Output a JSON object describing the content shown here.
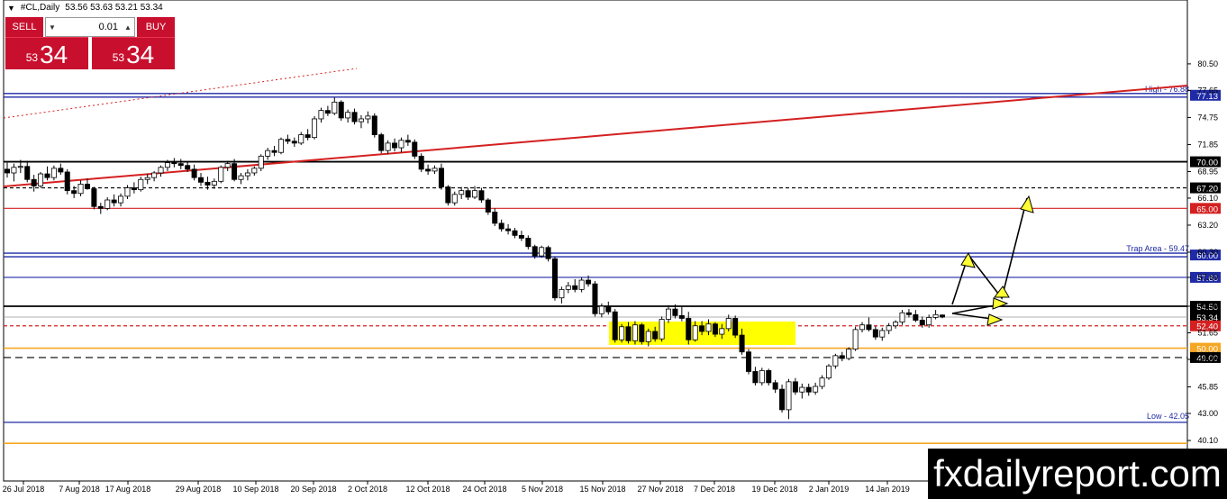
{
  "header": {
    "symbol": "#CL,Daily",
    "ohlc": "53.56 53.63 53.21 53.34"
  },
  "trade_panel": {
    "sell_label": "SELL",
    "buy_label": "BUY",
    "lot_value": "0.01",
    "sell_small": "53",
    "sell_big": "34",
    "buy_small": "53",
    "buy_big": "34"
  },
  "watermark": "fxdailyreport.com",
  "colors": {
    "bear": "#000000",
    "bull": "#ffffff",
    "red_line": "#d42020",
    "blue_line": "#1f2aa5",
    "black_line": "#000000",
    "yellow_zone": "#ffff00",
    "orange_line": "#f5a623",
    "arrow_fill": "#ffff33"
  },
  "chart_data": {
    "type": "candlestick",
    "y_ticks": [
      "80.50",
      "77.65",
      "74.75",
      "71.85",
      "68.95",
      "66.10",
      "63.20",
      "60.30",
      "57.60",
      "54.50",
      "51.65",
      "48.80",
      "45.85",
      "43.00",
      "40.10"
    ],
    "x_ticks": [
      "26 Jul 2018",
      "7 Aug 2018",
      "17 Aug 2018",
      "29 Aug 2018",
      "10 Sep 2018",
      "20 Sep 2018",
      "2 Oct 2018",
      "12 Oct 2018",
      "24 Oct 2018",
      "5 Nov 2018",
      "15 Nov 2018",
      "27 Nov 2018",
      "7 Dec 2018",
      "19 Dec 2018",
      "2 Jan 2019",
      "14 Jan 2019"
    ],
    "levels": [
      {
        "price": 77.13,
        "label": "77.13",
        "color": "blue",
        "tag_text": "High - 76.88",
        "style": "double"
      },
      {
        "price": 70.0,
        "label": "70.00",
        "color": "black",
        "style": "solid"
      },
      {
        "price": 67.2,
        "label": "67.20",
        "color": "black",
        "style": "dashed"
      },
      {
        "price": 65.0,
        "label": "65.00",
        "color": "red",
        "style": "solid"
      },
      {
        "price": 60.0,
        "label": "60.00",
        "color": "blue",
        "tag_text": "Trap Area - 59.47",
        "style": "double"
      },
      {
        "price": 57.6,
        "label": "57.60",
        "color": "blue",
        "style": "solid"
      },
      {
        "price": 54.5,
        "label": "54.50",
        "color": "black",
        "style": "solid"
      },
      {
        "price": 53.34,
        "label": "53.34",
        "color": "black",
        "style": "current"
      },
      {
        "price": 52.4,
        "label": "52.40",
        "color": "red",
        "style": "dashed"
      },
      {
        "price": 50.0,
        "label": "50.00",
        "color": "orange",
        "style": "solid"
      },
      {
        "price": 49.0,
        "label": "49.00",
        "color": "black",
        "style": "dashed"
      },
      {
        "price": 42.05,
        "label": "",
        "color": "blue",
        "tag_text": "Low - 42.05",
        "style": "solid"
      },
      {
        "price": 39.8,
        "label": "",
        "color": "orange",
        "style": "solid"
      }
    ],
    "candles": [
      [
        69.2,
        69.9,
        68.3,
        68.8
      ],
      [
        68.8,
        69.8,
        67.9,
        69.4
      ],
      [
        69.4,
        70.2,
        68.8,
        69.5
      ],
      [
        69.5,
        70.1,
        67.8,
        68.1
      ],
      [
        68.1,
        68.6,
        66.8,
        67.4
      ],
      [
        67.4,
        68.9,
        67.2,
        68.7
      ],
      [
        68.7,
        69.5,
        68.0,
        68.3
      ],
      [
        68.3,
        69.6,
        68.0,
        69.3
      ],
      [
        69.3,
        69.8,
        68.6,
        68.9
      ],
      [
        68.9,
        69.2,
        66.5,
        66.9
      ],
      [
        66.9,
        67.4,
        66.1,
        66.6
      ],
      [
        66.6,
        68.0,
        66.3,
        67.6
      ],
      [
        67.6,
        68.2,
        67.0,
        67.1
      ],
      [
        67.1,
        67.3,
        64.9,
        65.2
      ],
      [
        65.2,
        65.6,
        64.4,
        65.0
      ],
      [
        65.0,
        66.2,
        64.8,
        65.9
      ],
      [
        65.9,
        66.5,
        65.2,
        65.6
      ],
      [
        65.6,
        66.6,
        65.2,
        66.3
      ],
      [
        66.3,
        67.5,
        66.0,
        67.2
      ],
      [
        67.2,
        67.8,
        66.6,
        67.0
      ],
      [
        67.0,
        68.4,
        66.8,
        68.1
      ],
      [
        68.1,
        68.7,
        67.6,
        68.3
      ],
      [
        68.3,
        69.0,
        67.9,
        68.8
      ],
      [
        68.8,
        69.6,
        68.4,
        69.4
      ],
      [
        69.4,
        70.2,
        69.0,
        69.9
      ],
      [
        69.9,
        70.4,
        69.4,
        69.8
      ],
      [
        69.8,
        70.3,
        69.2,
        69.6
      ],
      [
        69.6,
        70.0,
        68.9,
        69.2
      ],
      [
        69.2,
        69.7,
        68.0,
        68.3
      ],
      [
        68.3,
        68.8,
        67.4,
        67.8
      ],
      [
        67.8,
        68.4,
        67.0,
        67.5
      ],
      [
        67.5,
        68.2,
        67.1,
        67.9
      ],
      [
        67.9,
        69.6,
        67.7,
        69.4
      ],
      [
        69.4,
        70.1,
        69.0,
        69.8
      ],
      [
        69.8,
        70.3,
        67.9,
        68.1
      ],
      [
        68.1,
        68.8,
        67.6,
        68.5
      ],
      [
        68.5,
        69.2,
        68.0,
        68.8
      ],
      [
        68.8,
        69.5,
        68.5,
        69.3
      ],
      [
        69.3,
        70.8,
        69.0,
        70.6
      ],
      [
        70.6,
        71.5,
        70.2,
        71.2
      ],
      [
        71.2,
        71.7,
        70.6,
        71.0
      ],
      [
        71.0,
        72.6,
        70.8,
        72.4
      ],
      [
        72.4,
        72.9,
        71.9,
        72.2
      ],
      [
        72.2,
        72.6,
        71.6,
        72.0
      ],
      [
        72.0,
        73.2,
        71.8,
        72.9
      ],
      [
        72.9,
        73.5,
        72.3,
        72.6
      ],
      [
        72.6,
        74.9,
        72.4,
        74.6
      ],
      [
        74.6,
        75.8,
        74.2,
        75.5
      ],
      [
        75.5,
        76.0,
        74.9,
        75.2
      ],
      [
        75.2,
        76.9,
        75.0,
        76.4
      ],
      [
        76.4,
        76.6,
        74.4,
        74.7
      ],
      [
        74.7,
        75.6,
        74.2,
        75.3
      ],
      [
        75.3,
        75.7,
        74.0,
        74.3
      ],
      [
        74.3,
        75.0,
        73.6,
        74.6
      ],
      [
        74.6,
        75.4,
        74.1,
        74.9
      ],
      [
        74.9,
        75.2,
        72.6,
        72.9
      ],
      [
        72.9,
        73.1,
        70.9,
        71.2
      ],
      [
        71.2,
        72.3,
        70.8,
        72.0
      ],
      [
        72.0,
        72.5,
        71.1,
        71.5
      ],
      [
        71.5,
        72.6,
        71.0,
        72.3
      ],
      [
        72.3,
        72.9,
        71.7,
        72.1
      ],
      [
        72.1,
        72.4,
        70.3,
        70.6
      ],
      [
        70.6,
        70.9,
        68.9,
        69.2
      ],
      [
        69.2,
        69.7,
        68.6,
        69.0
      ],
      [
        69.0,
        69.6,
        68.7,
        69.3
      ],
      [
        69.3,
        69.8,
        67.0,
        67.3
      ],
      [
        67.3,
        67.5,
        65.3,
        65.6
      ],
      [
        65.6,
        66.8,
        65.3,
        66.5
      ],
      [
        66.5,
        67.3,
        66.0,
        66.9
      ],
      [
        66.9,
        67.2,
        65.9,
        66.2
      ],
      [
        66.2,
        67.4,
        66.0,
        66.9
      ],
      [
        66.9,
        67.2,
        65.6,
        65.9
      ],
      [
        65.9,
        66.1,
        64.3,
        64.6
      ],
      [
        64.6,
        65.0,
        63.1,
        63.4
      ],
      [
        63.4,
        63.8,
        62.5,
        62.8
      ],
      [
        62.8,
        63.3,
        62.2,
        62.6
      ],
      [
        62.6,
        62.9,
        61.8,
        62.1
      ],
      [
        62.1,
        62.6,
        61.5,
        61.8
      ],
      [
        61.8,
        62.1,
        60.6,
        60.9
      ],
      [
        60.9,
        61.1,
        59.6,
        59.9
      ],
      [
        59.9,
        61.0,
        59.7,
        60.8
      ],
      [
        60.8,
        61.0,
        59.3,
        59.6
      ],
      [
        59.6,
        59.8,
        55.1,
        55.4
      ],
      [
        55.4,
        56.6,
        54.8,
        56.3
      ],
      [
        56.3,
        57.1,
        55.9,
        56.7
      ],
      [
        56.7,
        57.4,
        56.0,
        56.3
      ],
      [
        56.3,
        57.6,
        56.0,
        57.3
      ],
      [
        57.3,
        57.8,
        56.6,
        56.9
      ],
      [
        56.9,
        57.2,
        53.4,
        53.7
      ],
      [
        53.7,
        54.8,
        53.3,
        54.5
      ],
      [
        54.5,
        55.0,
        53.6,
        53.9
      ],
      [
        53.9,
        54.2,
        50.6,
        50.9
      ],
      [
        50.9,
        52.6,
        50.6,
        52.3
      ],
      [
        52.3,
        52.8,
        50.5,
        50.8
      ],
      [
        50.8,
        52.9,
        50.4,
        52.5
      ],
      [
        52.5,
        52.7,
        50.4,
        50.7
      ],
      [
        50.7,
        52.1,
        50.2,
        51.8
      ],
      [
        51.8,
        52.3,
        50.7,
        51.0
      ],
      [
        51.0,
        53.4,
        50.7,
        53.1
      ],
      [
        53.1,
        54.6,
        52.7,
        54.2
      ],
      [
        54.2,
        54.7,
        53.2,
        53.5
      ],
      [
        53.5,
        54.5,
        52.9,
        53.2
      ],
      [
        53.2,
        53.9,
        50.4,
        50.9
      ],
      [
        50.9,
        52.9,
        50.7,
        52.4
      ],
      [
        52.4,
        52.9,
        51.4,
        51.8
      ],
      [
        51.8,
        53.1,
        51.4,
        52.6
      ],
      [
        52.6,
        52.8,
        51.2,
        51.5
      ],
      [
        51.5,
        52.6,
        51.0,
        52.1
      ],
      [
        52.1,
        53.6,
        51.8,
        53.2
      ],
      [
        53.2,
        53.5,
        51.1,
        51.4
      ],
      [
        51.4,
        52.1,
        49.3,
        49.6
      ],
      [
        49.6,
        49.9,
        47.2,
        47.5
      ],
      [
        47.5,
        48.0,
        46.0,
        46.3
      ],
      [
        46.3,
        47.9,
        46.0,
        47.6
      ],
      [
        47.6,
        47.8,
        46.0,
        46.3
      ],
      [
        46.3,
        46.6,
        45.2,
        45.6
      ],
      [
        45.6,
        46.1,
        43.1,
        43.4
      ],
      [
        43.4,
        46.7,
        42.4,
        46.4
      ],
      [
        46.4,
        46.8,
        45.0,
        45.3
      ],
      [
        45.3,
        46.2,
        44.6,
        45.8
      ],
      [
        45.8,
        46.2,
        44.9,
        45.3
      ],
      [
        45.3,
        46.3,
        45.0,
        45.9
      ],
      [
        45.9,
        47.1,
        45.6,
        46.8
      ],
      [
        46.8,
        48.3,
        46.6,
        48.1
      ],
      [
        48.1,
        49.4,
        47.8,
        49.2
      ],
      [
        49.2,
        49.6,
        48.6,
        48.9
      ],
      [
        48.9,
        50.1,
        48.7,
        49.9
      ],
      [
        49.9,
        52.3,
        49.7,
        52.0
      ],
      [
        52.0,
        52.8,
        51.7,
        52.5
      ],
      [
        52.5,
        53.3,
        51.8,
        52.0
      ],
      [
        52.0,
        52.4,
        50.9,
        51.2
      ],
      [
        51.2,
        52.2,
        50.8,
        51.9
      ],
      [
        51.9,
        52.7,
        51.5,
        52.4
      ],
      [
        52.4,
        53.0,
        52.1,
        52.8
      ],
      [
        52.8,
        54.1,
        52.5,
        53.8
      ],
      [
        53.8,
        54.2,
        53.3,
        53.6
      ],
      [
        53.6,
        54.1,
        52.8,
        53.0
      ],
      [
        53.0,
        53.4,
        52.2,
        52.5
      ],
      [
        52.5,
        53.6,
        52.2,
        53.3
      ],
      [
        53.3,
        54.1,
        53.1,
        53.6
      ],
      [
        53.56,
        53.63,
        53.21,
        53.34
      ]
    ]
  }
}
